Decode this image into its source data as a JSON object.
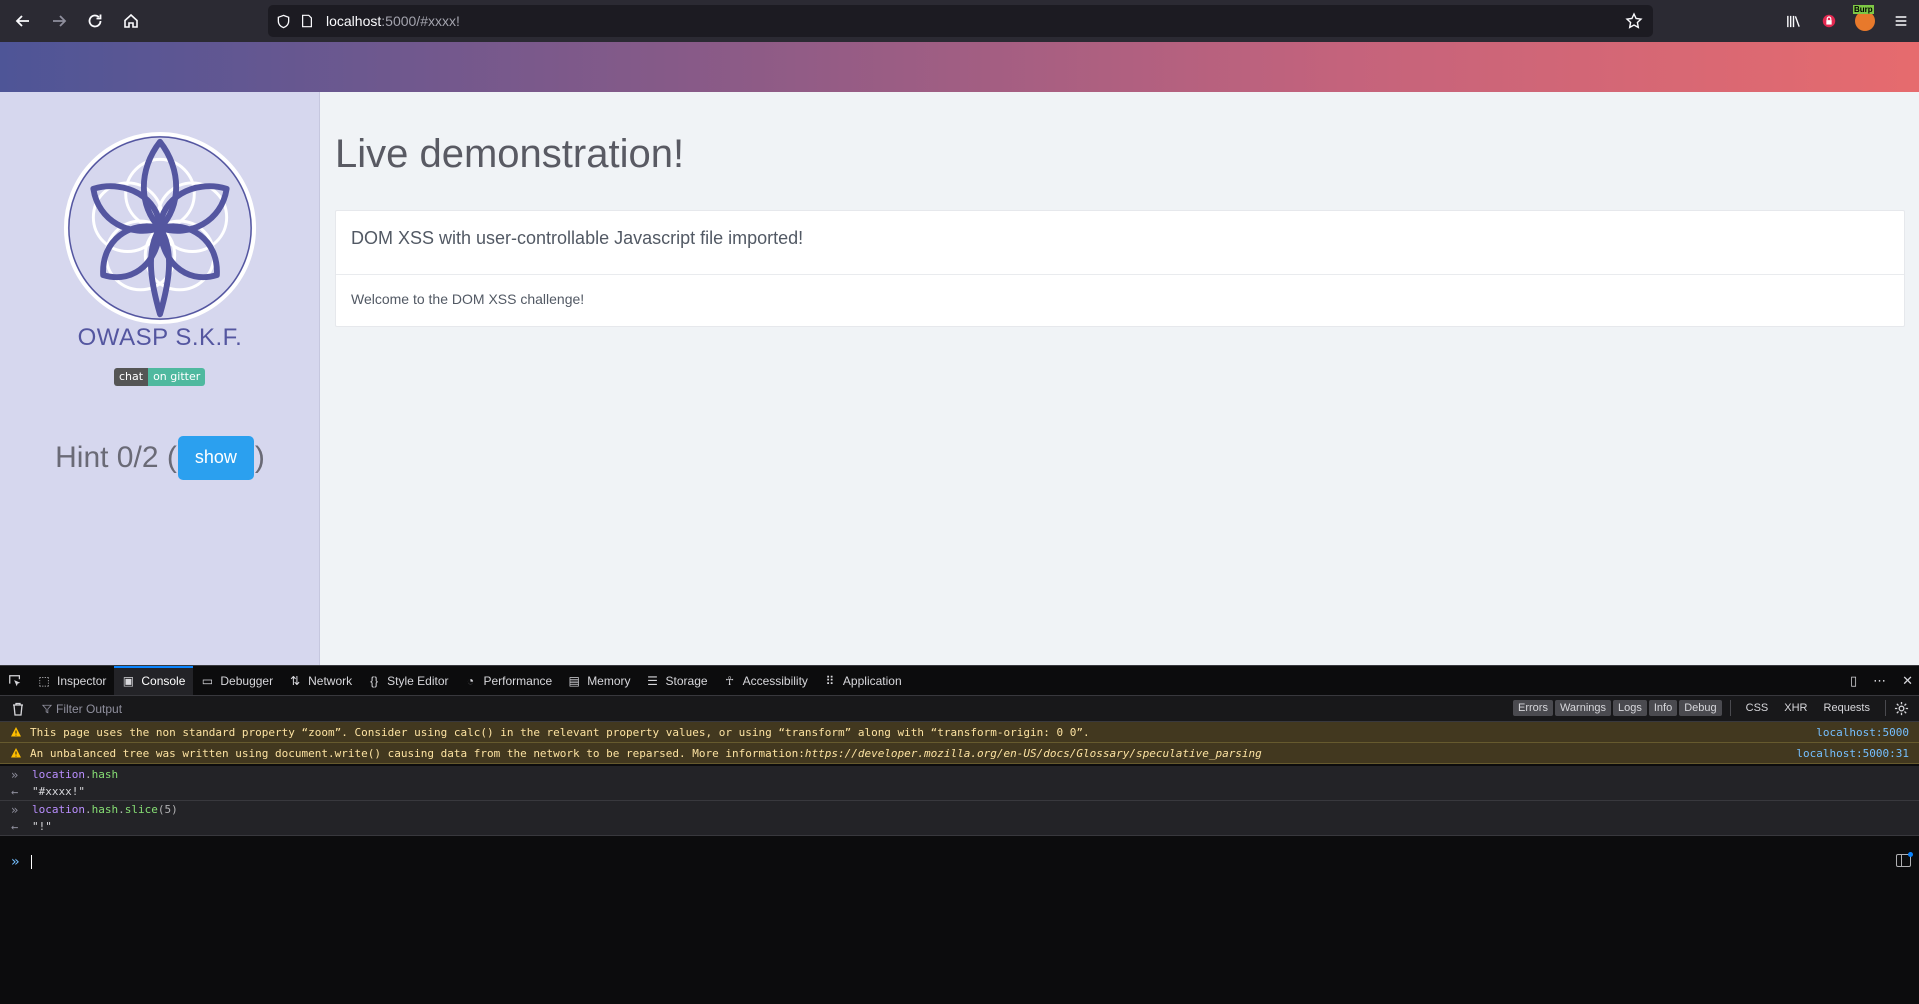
{
  "browser": {
    "url_host": "localhost",
    "url_rest": ":5000/#xxxx!",
    "burp_label": "Burp"
  },
  "sidebar": {
    "brand": "OWASP S.K.F.",
    "badge_left": "chat",
    "badge_right": "on gitter",
    "hint_prefix": "Hint 0/2 (",
    "hint_button": "show",
    "hint_suffix": ")"
  },
  "main": {
    "title": "Live demonstration!",
    "panel_heading": "DOM XSS with user-controllable Javascript file imported!",
    "panel_body": "Welcome to the DOM XSS challenge!"
  },
  "devtools": {
    "tabs": [
      {
        "label": "Inspector",
        "icon": "inspector-icon"
      },
      {
        "label": "Console",
        "icon": "console-icon"
      },
      {
        "label": "Debugger",
        "icon": "debugger-icon"
      },
      {
        "label": "Network",
        "icon": "network-icon"
      },
      {
        "label": "Style Editor",
        "icon": "style-editor-icon"
      },
      {
        "label": "Performance",
        "icon": "performance-icon"
      },
      {
        "label": "Memory",
        "icon": "memory-icon"
      },
      {
        "label": "Storage",
        "icon": "storage-icon"
      },
      {
        "label": "Accessibility",
        "icon": "accessibility-icon"
      },
      {
        "label": "Application",
        "icon": "application-icon"
      }
    ],
    "active_tab": "Console",
    "filter_placeholder": "Filter Output",
    "filters": [
      "Errors",
      "Warnings",
      "Logs",
      "Info",
      "Debug"
    ],
    "request_filters": [
      "CSS",
      "XHR",
      "Requests"
    ],
    "messages": {
      "warn1": {
        "text": "This page uses the non standard property “zoom”. Consider using calc() in the relevant property values, or using “transform” along with “transform-origin: 0 0”.",
        "source": "localhost:5000"
      },
      "warn2": {
        "text": "An unbalanced tree was written using document.write() causing data from the network to be reparsed. More information: ",
        "link": "https://developer.mozilla.org/en-US/docs/Glossary/speculative_parsing",
        "source": "localhost:5000:31"
      },
      "in1_obj": "location",
      "in1_prop": "hash",
      "out1": "\"#xxxx!\"",
      "in2_obj": "location",
      "in2_prop": "hash",
      "in2_method": "slice",
      "in2_arg": "(5)",
      "out2": "\"!\""
    }
  }
}
